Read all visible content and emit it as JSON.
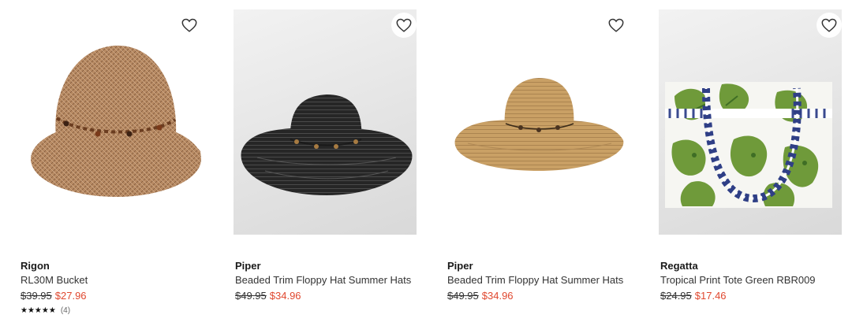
{
  "products": [
    {
      "brand": "Rigon",
      "title": "RL30M Bucket",
      "was_price": "$39.95",
      "sale_price": "$27.96",
      "rating_stars": "★★★★★",
      "rating_count": "(4)",
      "image_icon": "brown-bucket-hat-image",
      "favorite_icon": "heart-icon"
    },
    {
      "brand": "Piper",
      "title": "Beaded Trim Floppy Hat Summer Hats",
      "was_price": "$49.95",
      "sale_price": "$34.96",
      "image_icon": "black-floppy-hat-image",
      "favorite_icon": "heart-icon"
    },
    {
      "brand": "Piper",
      "title": "Beaded Trim Floppy Hat Summer Hats",
      "was_price": "$49.95",
      "sale_price": "$34.96",
      "image_icon": "tan-floppy-hat-image",
      "favorite_icon": "heart-icon"
    },
    {
      "brand": "Regatta",
      "title": "Tropical Print Tote Green RBR009",
      "was_price": "$24.95",
      "sale_price": "$17.46",
      "image_icon": "tropical-tote-bag-image",
      "favorite_icon": "heart-icon"
    }
  ],
  "colors": {
    "sale_price": "#e0482f",
    "text": "#1a1a1a"
  }
}
